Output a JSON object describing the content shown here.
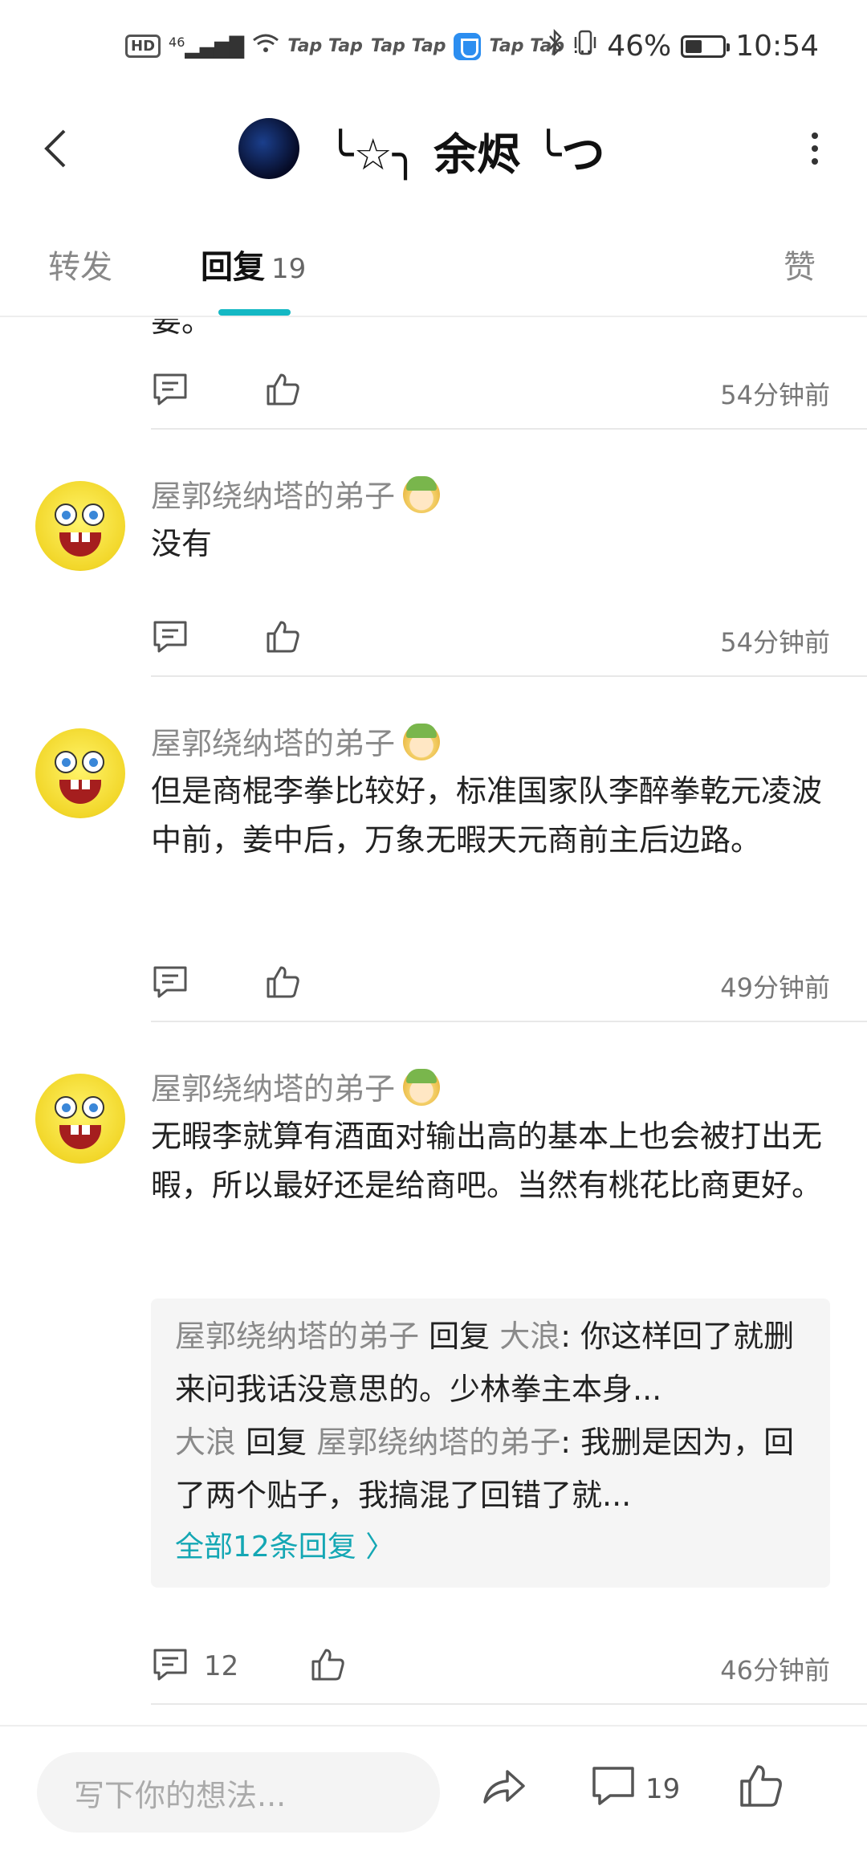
{
  "status_bar": {
    "left_items": [
      "HD",
      "46",
      "Tap Tap",
      "Tap Tap",
      "Tap Tap",
      "..."
    ],
    "battery": "46%",
    "battery_fraction": 0.46,
    "time": "10:54"
  },
  "header": {
    "title": "╰☆╮ 余烬 ╰つ"
  },
  "tabs": [
    {
      "label": "转发"
    },
    {
      "label": "回复",
      "count": "19"
    },
    {
      "label": "赞"
    }
  ],
  "cut_off_text": "要。",
  "top_action": {
    "time": "54分钟前"
  },
  "comments": [
    {
      "username": "屋郭绕纳塔的弟子",
      "text": "没有",
      "time": "54分钟前"
    },
    {
      "username": "屋郭绕纳塔的弟子",
      "text": "但是商棍李拳比较好，标准国家队李醉拳乾元凌波中前，姜中后，万象无暇天元商前主后边路。",
      "time": "49分钟前"
    },
    {
      "username": "屋郭绕纳塔的弟子",
      "text": "无暇李就算有酒面对输出高的基本上也会被打出无暇，所以最好还是给商吧。当然有桃花比商更好。",
      "replies": [
        {
          "from": "屋郭绕纳塔的弟子",
          "verb": "回复",
          "to": "大浪",
          "text": ": 你这样回了就删来问我话没意思的。少林拳主本身..."
        },
        {
          "from": "大浪",
          "verb": "回复",
          "to": "屋郭绕纳塔的弟子",
          "text": ": 我删是因为，回了两个贴子，我搞混了回错了就..."
        }
      ],
      "view_all": "全部12条回复 〉",
      "reply_count": "12",
      "time": "46分钟前"
    }
  ],
  "bottom_bar": {
    "input_placeholder": "写下你的想法...",
    "comment_count": "19"
  }
}
